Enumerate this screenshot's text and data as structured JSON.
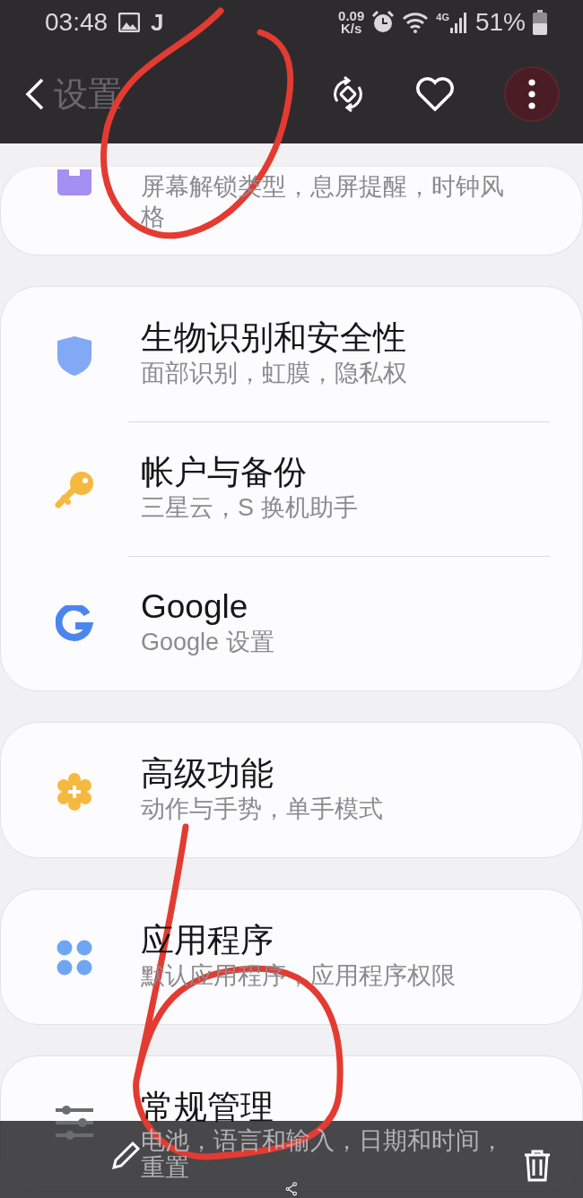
{
  "status_bar": {
    "time": "03:48",
    "app_letter": "J",
    "net_speed": "0.09",
    "net_speed_unit": "K/s",
    "network": "4G",
    "battery": "51%"
  },
  "toolbar": {
    "title": "设置"
  },
  "cards": [
    {
      "items": [
        {
          "subtitle": "屏幕解锁类型，息屏提醒，时钟风格"
        }
      ]
    },
    {
      "items": [
        {
          "title": "生物识别和安全性",
          "subtitle": "面部识别，虹膜，隐私权"
        },
        {
          "title": "帐户与备份",
          "subtitle": "三星云，S 换机助手"
        },
        {
          "title": "Google",
          "subtitle": "Google 设置"
        }
      ]
    },
    {
      "items": [
        {
          "title": "高级功能",
          "subtitle": "动作与手势，单手模式"
        }
      ]
    },
    {
      "items": [
        {
          "title": "应用程序",
          "subtitle": "默认应用程序，应用程序权限"
        }
      ]
    },
    {
      "items": [
        {
          "title": "常规管理",
          "subtitle": "电池，语言和输入，日期和时间，重置"
        }
      ]
    }
  ]
}
